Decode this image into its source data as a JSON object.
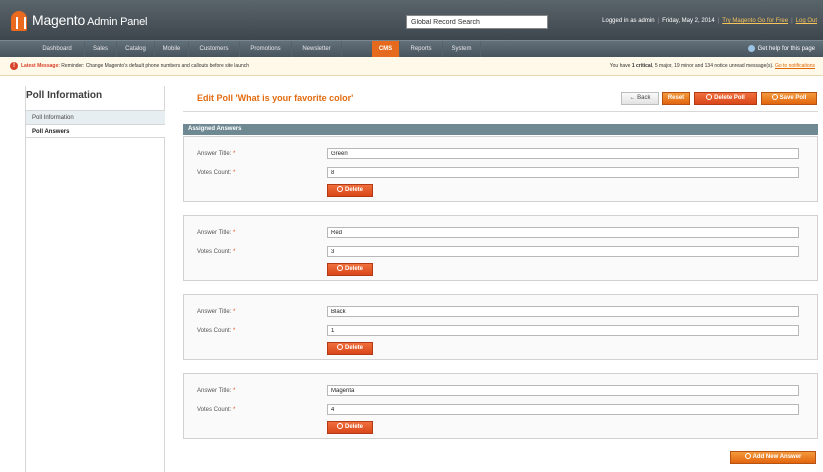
{
  "header": {
    "logo_text": "Magento",
    "logo_sub": "Admin Panel",
    "search_value": "Global Record Search",
    "logged_in": "Logged in as admin",
    "date": "Friday, May 2, 2014",
    "try_link": "Try Magento Go for Free",
    "logout": "Log Out"
  },
  "nav": {
    "items": [
      "Dashboard",
      "Sales",
      "Catalog",
      "Mobile",
      "Customers",
      "Promotions",
      "Newsletter",
      "CMS",
      "Reports",
      "System"
    ],
    "active": "CMS",
    "help": "Get help for this page"
  },
  "message": {
    "label": "Latest Message:",
    "text": "Reminder: Change Magento's default phone numbers and callouts before site launch",
    "right_prefix": "You have",
    "critical": "1 critical",
    "right_rest": ", 5 major, 19 minor and 134 notice unread message(s).",
    "link": "Go to notifications"
  },
  "sidebar": {
    "title": "Poll Information",
    "tabs": [
      "Poll Information",
      "Poll Answers"
    ]
  },
  "page": {
    "title": "Edit Poll 'What is your favorite color'",
    "buttons": {
      "back": "Back",
      "reset": "Reset",
      "delete_poll": "Delete Poll",
      "save_poll": "Save Poll"
    },
    "section_title": "Assigned Answers"
  },
  "answers": [
    {
      "title_label": "Answer Title:",
      "votes_label": "Votes Count:",
      "req": "*",
      "title": "Green",
      "votes": "8",
      "delete": "Delete"
    },
    {
      "title_label": "Answer Title:",
      "votes_label": "Votes Count:",
      "req": "*",
      "title": "Red",
      "votes": "3",
      "delete": "Delete"
    },
    {
      "title_label": "Answer Title:",
      "votes_label": "Votes Count:",
      "req": "*",
      "title": "Black",
      "votes": "1",
      "delete": "Delete"
    },
    {
      "title_label": "Answer Title:",
      "votes_label": "Votes Count:",
      "req": "*",
      "title": "Magenta",
      "votes": "4",
      "delete": "Delete"
    }
  ],
  "add_new_answer": "Add New Answer",
  "colors": {
    "accent": "#e66a1d",
    "section_header": "#6f8992",
    "title_orange": "#e36b10"
  }
}
